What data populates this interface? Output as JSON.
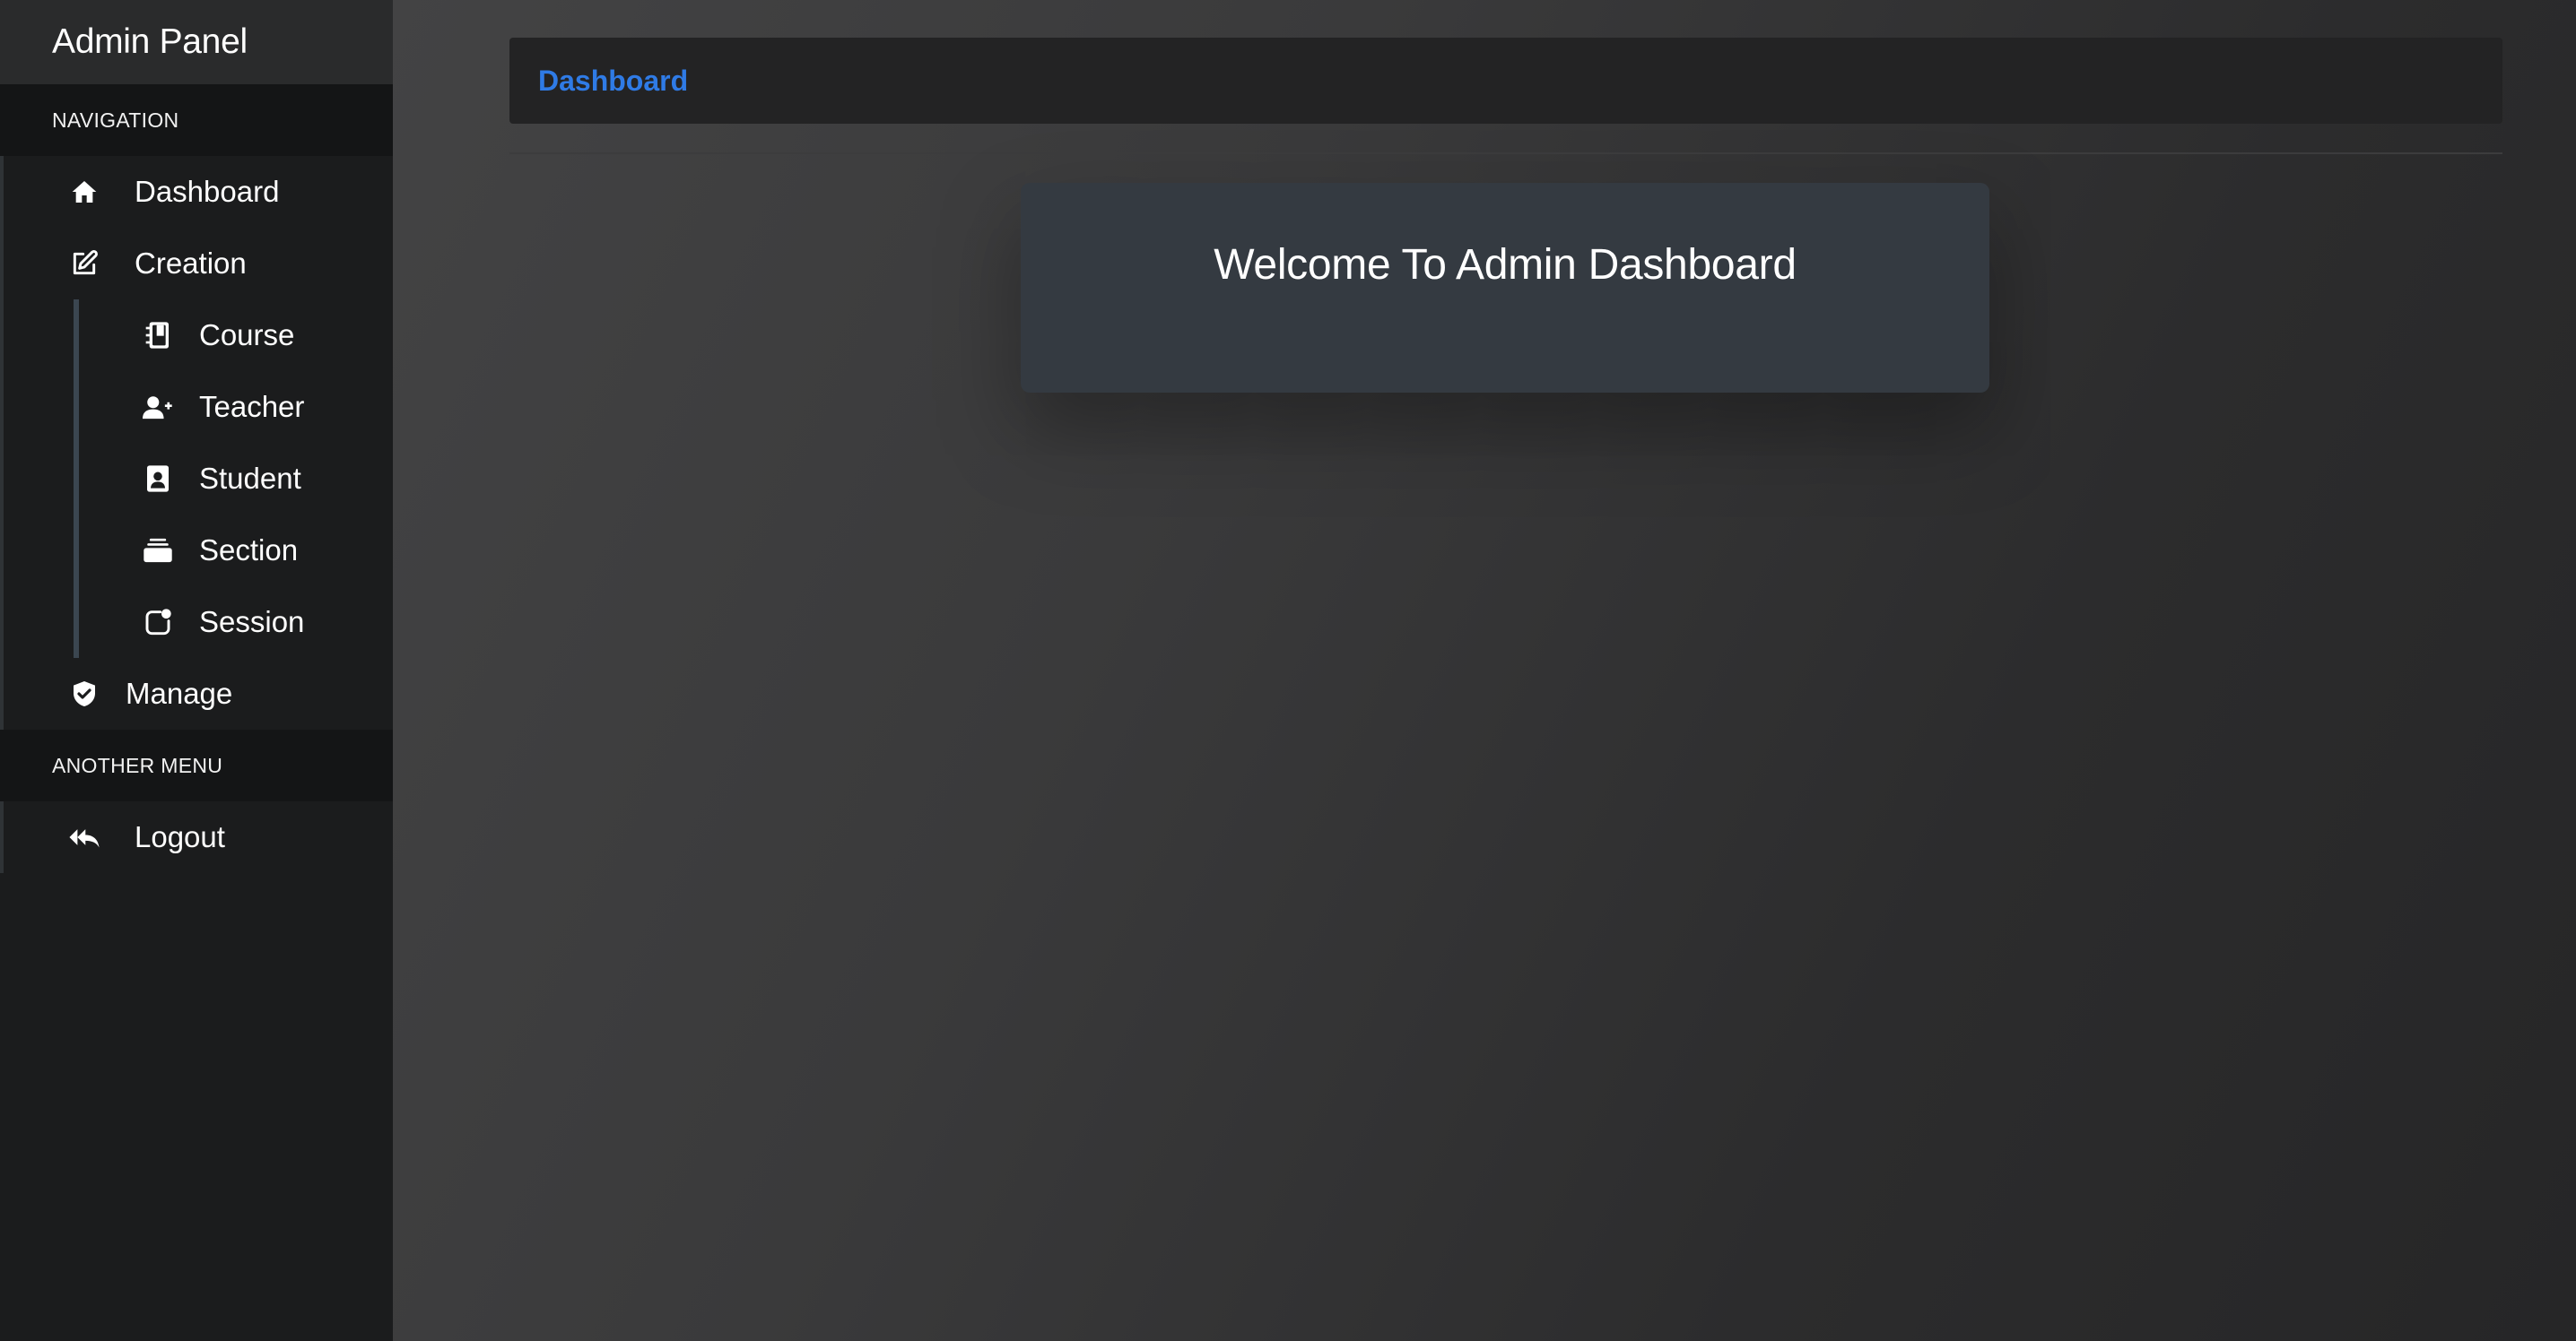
{
  "sidebar": {
    "brand": "Admin Panel",
    "sections": [
      {
        "header": "NAVIGATION",
        "items": [
          {
            "label": "Dashboard",
            "icon": "home-icon"
          },
          {
            "label": "Creation",
            "icon": "edit-icon",
            "children": [
              {
                "label": "Course",
                "icon": "notebook-icon"
              },
              {
                "label": "Teacher",
                "icon": "user-plus-icon"
              },
              {
                "label": "Student",
                "icon": "contact-card-icon"
              },
              {
                "label": "Section",
                "icon": "layers-icon"
              },
              {
                "label": "Session",
                "icon": "session-icon"
              }
            ]
          },
          {
            "label": "Manage",
            "icon": "shield-check-icon"
          }
        ]
      },
      {
        "header": "ANOTHER MENU",
        "items": [
          {
            "label": "Logout",
            "icon": "reply-all-icon"
          }
        ]
      }
    ]
  },
  "main": {
    "breadcrumb": "Dashboard",
    "welcome_title": "Welcome To Admin Dashboard"
  },
  "colors": {
    "accent": "#2f7be6",
    "sidebar_bg": "#1b1c1d",
    "card_bg": "#343a41"
  }
}
